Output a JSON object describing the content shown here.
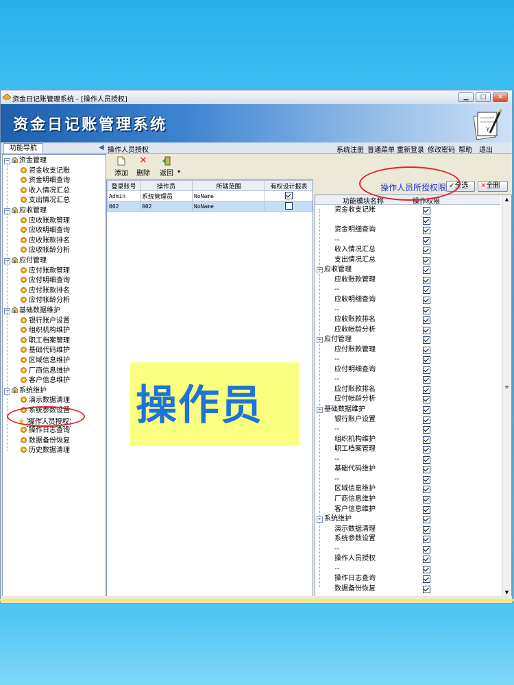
{
  "window": {
    "title": "资金日记账管理系统 - [操作人员授权]",
    "controls": [
      "minimize",
      "maximize",
      "close"
    ]
  },
  "banner": {
    "title": "资金日记账管理系统"
  },
  "nav": {
    "tab": "功能导航",
    "page_title": "操作人员授权",
    "menu": [
      "系统注册",
      "普通菜单",
      "重新登录",
      "修改密码",
      "帮助",
      "退出"
    ]
  },
  "tree": [
    {
      "group": "资金管理",
      "items": [
        "资金收支记账",
        "资金明细查询",
        "收入情况汇总",
        "支出情况汇总"
      ]
    },
    {
      "group": "应收管理",
      "items": [
        "应收账款管理",
        "应收明细查询",
        "应收账款排名",
        "应收帐龄分析"
      ]
    },
    {
      "group": "应付管理",
      "items": [
        "应付账款管理",
        "应付明细查询",
        "应付账款排名",
        "应付帐龄分析"
      ]
    },
    {
      "group": "基础数据维护",
      "items": [
        "银行账户设置",
        "组织机构维护",
        "职工档案管理",
        "基础代码维护",
        "区域信息维护",
        "厂商信息维护",
        "客户信息维护"
      ]
    },
    {
      "group": "系统维护",
      "items": [
        "演示数据清理",
        "系统参数设置",
        "操作人员授权",
        "操作日志查询",
        "数据备份恢复",
        "历史数据清理"
      ]
    }
  ],
  "toolbar": {
    "add": "添加",
    "delete": "删除",
    "back": "返回"
  },
  "users_table": {
    "headers": [
      "登录账号",
      "操作员",
      "所辖范围",
      "有权设计报表"
    ],
    "rows": [
      {
        "account": "Admin",
        "operator": "系统管理员",
        "scope": "NoName",
        "design": true
      },
      {
        "account": "002",
        "operator": "002",
        "scope": "NoName",
        "design": false
      }
    ]
  },
  "overlay_label": "操作员",
  "permissions": {
    "title": "操作人员所授权限",
    "select_all": "全选",
    "clear_all": "全删",
    "headers": [
      "功能模块名称",
      "操作权限"
    ],
    "rows": [
      {
        "label": "资金收支记账",
        "type": "item",
        "checked": true
      },
      {
        "label": "",
        "type": "blank",
        "checked": true
      },
      {
        "label": "资金明细查询",
        "type": "item",
        "checked": true
      },
      {
        "label": "--",
        "type": "dash",
        "checked": true
      },
      {
        "label": "收入情况汇总",
        "type": "item",
        "checked": true
      },
      {
        "label": "支出情况汇总",
        "type": "item",
        "checked": true
      },
      {
        "label": "应收管理",
        "type": "group",
        "checked": true
      },
      {
        "label": "应收账款管理",
        "type": "item",
        "checked": true
      },
      {
        "label": "--",
        "type": "dash",
        "checked": true
      },
      {
        "label": "应收明细查询",
        "type": "item",
        "checked": true
      },
      {
        "label": "--",
        "type": "dash",
        "checked": true
      },
      {
        "label": "应收账款排名",
        "type": "item",
        "checked": true
      },
      {
        "label": "应收帐龄分析",
        "type": "item",
        "checked": true
      },
      {
        "label": "应付管理",
        "type": "group",
        "checked": true
      },
      {
        "label": "应付账款管理",
        "type": "item",
        "checked": true
      },
      {
        "label": "--",
        "type": "dash",
        "checked": true
      },
      {
        "label": "应付明细查询",
        "type": "item",
        "checked": true
      },
      {
        "label": "--",
        "type": "dash",
        "checked": true
      },
      {
        "label": "应付账款排名",
        "type": "item",
        "checked": true
      },
      {
        "label": "应付帐龄分析",
        "type": "item",
        "checked": true
      },
      {
        "label": "基础数据维护",
        "type": "group",
        "checked": true
      },
      {
        "label": "银行账户设置",
        "type": "item",
        "checked": true
      },
      {
        "label": "--",
        "type": "dash",
        "checked": true
      },
      {
        "label": "组织机构维护",
        "type": "item",
        "checked": true
      },
      {
        "label": "职工档案管理",
        "type": "item",
        "checked": true
      },
      {
        "label": "--",
        "type": "dash",
        "checked": true
      },
      {
        "label": "基础代码维护",
        "type": "item",
        "checked": true
      },
      {
        "label": "--",
        "type": "dash",
        "checked": true
      },
      {
        "label": "区域信息维护",
        "type": "item",
        "checked": true
      },
      {
        "label": "厂商信息维护",
        "type": "item",
        "checked": true
      },
      {
        "label": "客户信息维护",
        "type": "item",
        "checked": true
      },
      {
        "label": "系统维护",
        "type": "group",
        "checked": true
      },
      {
        "label": "演示数据清理",
        "type": "item",
        "checked": true
      },
      {
        "label": "系统参数设置",
        "type": "item",
        "checked": true
      },
      {
        "label": "--",
        "type": "dash",
        "checked": true
      },
      {
        "label": "操作人员授权",
        "type": "item",
        "checked": true
      },
      {
        "label": "--",
        "type": "dash",
        "checked": true
      },
      {
        "label": "操作日志查询",
        "type": "item",
        "checked": true
      },
      {
        "label": "数据备份恢复",
        "type": "item",
        "checked": true
      }
    ]
  },
  "colors": {
    "annotation_ring": "#e0242b",
    "overlay_bg": "#fbff80",
    "overlay_text": "#1e73d8",
    "perm_title": "#1a2fd8"
  }
}
